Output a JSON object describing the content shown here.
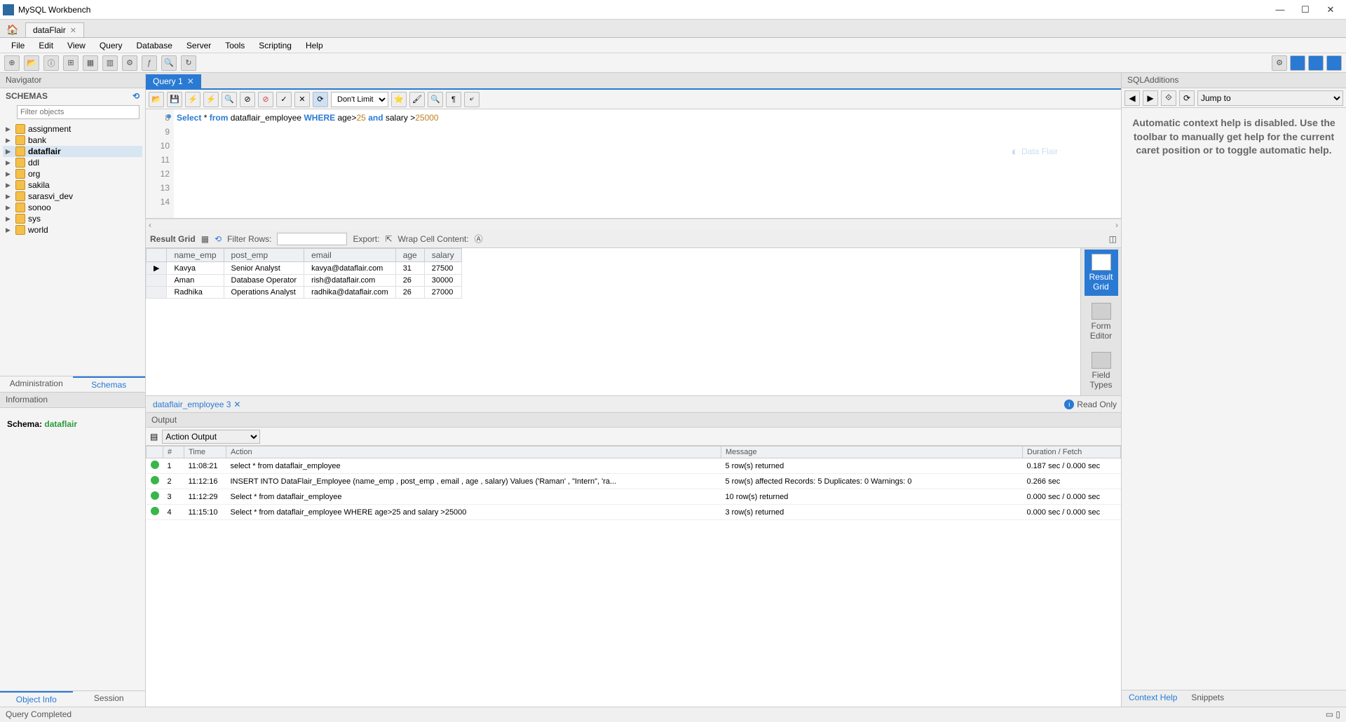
{
  "window": {
    "title": "MySQL Workbench",
    "minimize": "—",
    "maximize": "☐",
    "close": "✕"
  },
  "connection_tab": {
    "label": "dataFlair"
  },
  "menubar": [
    "File",
    "Edit",
    "View",
    "Query",
    "Database",
    "Server",
    "Tools",
    "Scripting",
    "Help"
  ],
  "navigator": {
    "title": "Navigator",
    "schemas_label": "SCHEMAS",
    "filter_placeholder": "Filter objects",
    "items": [
      {
        "label": "assignment"
      },
      {
        "label": "bank"
      },
      {
        "label": "dataflair",
        "selected": true
      },
      {
        "label": "ddl"
      },
      {
        "label": "org"
      },
      {
        "label": "sakila"
      },
      {
        "label": "sarasvi_dev"
      },
      {
        "label": "sonoo"
      },
      {
        "label": "sys"
      },
      {
        "label": "world"
      }
    ],
    "tabs": {
      "admin": "Administration",
      "schemas": "Schemas"
    },
    "info_title": "Information",
    "info_label": "Schema:",
    "info_value": "dataflair",
    "footer_tabs": {
      "object": "Object Info",
      "session": "Session"
    }
  },
  "query": {
    "tab_label": "Query 1",
    "row_limit": "Don't Limit",
    "line_start": 8,
    "line_count": 7,
    "sql_parts": {
      "p1": "Select",
      "p2": " * ",
      "p3": "from",
      "p4": " dataflair_employee ",
      "p5": "WHERE",
      "p6": " age>",
      "p7": "25",
      "p8": " and",
      "p9": " salary >",
      "p10": "25000"
    },
    "watermark": "Data Flair"
  },
  "result": {
    "grid_label": "Result Grid",
    "filter_label": "Filter Rows:",
    "export_label": "Export:",
    "wrap_label": "Wrap Cell Content:",
    "columns": [
      "name_emp",
      "post_emp",
      "email",
      "age",
      "salary"
    ],
    "rows": [
      {
        "c": [
          "Kavya",
          "Senior Analyst",
          "kavya@dataflair.com",
          "31",
          "27500"
        ]
      },
      {
        "c": [
          "Aman",
          "Database Operator",
          "rish@dataflair.com",
          "26",
          "30000"
        ]
      },
      {
        "c": [
          "Radhika",
          "Operations Analyst",
          "radhika@dataflair.com",
          "26",
          "27000"
        ]
      }
    ],
    "side": {
      "grid": "Result Grid",
      "form": "Form Editor",
      "field": "Field Types"
    },
    "tab_label": "dataflair_employee 3",
    "readonly": "Read Only"
  },
  "output": {
    "title": "Output",
    "selector": "Action Output",
    "columns": [
      "",
      "#",
      "Time",
      "Action",
      "Message",
      "Duration / Fetch"
    ],
    "rows": [
      {
        "n": "1",
        "t": "11:08:21",
        "a": "select * from dataflair_employee",
        "m": "5 row(s) returned",
        "d": "0.187 sec / 0.000 sec"
      },
      {
        "n": "2",
        "t": "11:12:16",
        "a": "INSERT  INTO DataFlair_Employee (name_emp , post_emp , email , age , salary) Values ('Raman' ,  \"Intern\", 'ra...",
        "m": "5 row(s) affected Records: 5  Duplicates: 0  Warnings: 0",
        "d": "0.266 sec"
      },
      {
        "n": "3",
        "t": "11:12:29",
        "a": "Select * from dataflair_employee",
        "m": "10 row(s) returned",
        "d": "0.000 sec / 0.000 sec"
      },
      {
        "n": "4",
        "t": "11:15:10",
        "a": "Select * from dataflair_employee WHERE age>25 and salary >25000",
        "m": "3 row(s) returned",
        "d": "0.000 sec / 0.000 sec"
      }
    ]
  },
  "sql_additions": {
    "title": "SQLAdditions",
    "jump": "Jump to",
    "help": "Automatic context help is disabled. Use the toolbar to manually get help for the current caret position or to toggle automatic help.",
    "tabs": {
      "ctx": "Context Help",
      "snip": "Snippets"
    }
  },
  "status": "Query Completed"
}
